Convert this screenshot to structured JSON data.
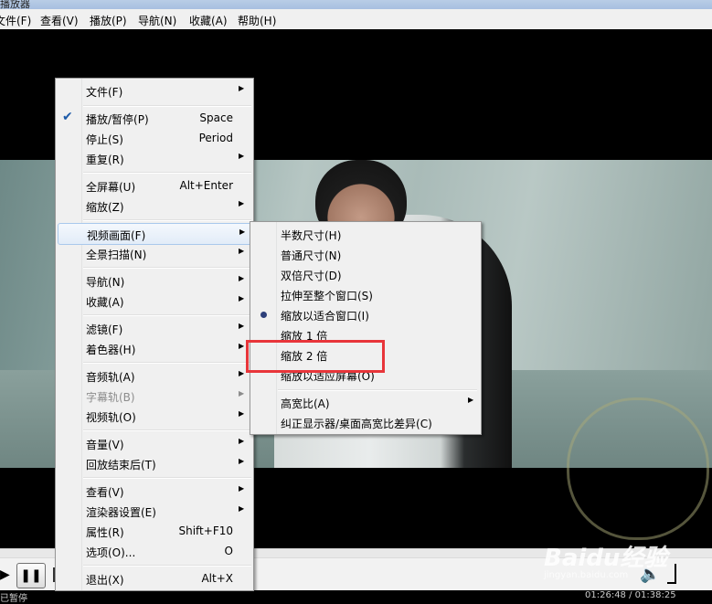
{
  "titlebar": {
    "title": "播放器"
  },
  "menubar": [
    "文件(F)",
    "查看(V)",
    "播放(P)",
    "导航(N)",
    "收藏(A)",
    "帮助(H)"
  ],
  "main_menu": {
    "items": [
      {
        "label": "文件(F)",
        "submenu": true
      },
      {
        "label": "播放/暂停(P)",
        "shortcut": "Space",
        "checked": true
      },
      {
        "label": "停止(S)",
        "shortcut": "Period"
      },
      {
        "label": "重复(R)",
        "submenu": true
      },
      {
        "label": "全屏幕(U)",
        "shortcut": "Alt+Enter"
      },
      {
        "label": "缩放(Z)",
        "submenu": true
      },
      {
        "label": "视频画面(F)",
        "submenu": true,
        "highlighted": true
      },
      {
        "label": "全景扫描(N)",
        "submenu": true
      },
      {
        "label": "导航(N)",
        "submenu": true
      },
      {
        "label": "收藏(A)",
        "submenu": true
      },
      {
        "label": "滤镜(F)",
        "submenu": true
      },
      {
        "label": "着色器(H)",
        "submenu": true
      },
      {
        "label": "音频轨(A)",
        "submenu": true
      },
      {
        "label": "字幕轨(B)",
        "submenu": true,
        "disabled": true
      },
      {
        "label": "视频轨(O)",
        "submenu": true
      },
      {
        "label": "音量(V)",
        "submenu": true
      },
      {
        "label": "回放结束后(T)",
        "submenu": true
      },
      {
        "label": "查看(V)",
        "submenu": true
      },
      {
        "label": "渲染器设置(E)",
        "submenu": true
      },
      {
        "label": "属性(R)",
        "shortcut": "Shift+F10"
      },
      {
        "label": "选项(O)...",
        "shortcut": "O"
      },
      {
        "label": "退出(X)",
        "shortcut": "Alt+X"
      }
    ]
  },
  "sub_menu": {
    "items": [
      {
        "label": "半数尺寸(H)"
      },
      {
        "label": "普通尺寸(N)"
      },
      {
        "label": "双倍尺寸(D)"
      },
      {
        "label": "拉伸至整个窗口(S)"
      },
      {
        "label": "缩放以适合窗口(I)",
        "selected": true
      },
      {
        "label": "缩放 1 倍"
      },
      {
        "label": "缩放 2 倍"
      },
      {
        "label": "缩放以适应屏幕(O)"
      },
      {
        "label": "高宽比(A)",
        "submenu": true
      },
      {
        "label": "纠正显示器/桌面高宽比差异(C)"
      }
    ]
  },
  "status": {
    "state": "已暂停",
    "time": "01:26:48 / 01:38:25"
  },
  "watermark": {
    "text": "Baidu经验",
    "sub": "jingyan.baidu.com"
  },
  "colors": {
    "highlight_box": "#e8353a"
  }
}
